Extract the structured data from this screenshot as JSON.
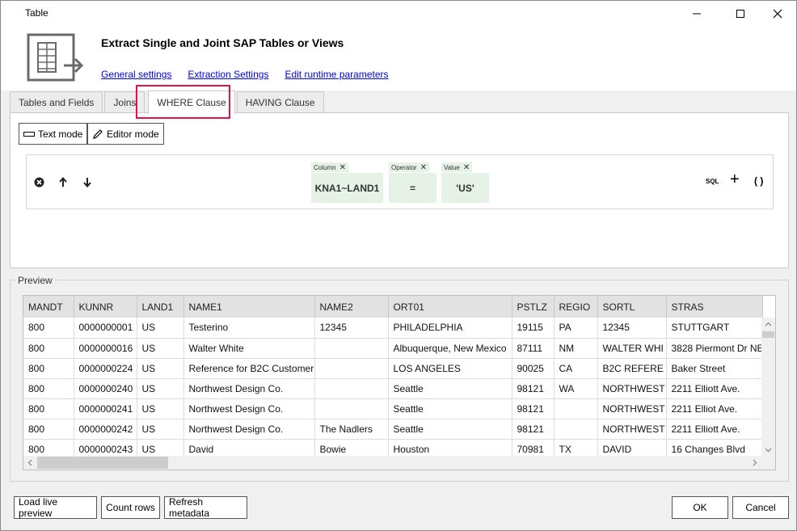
{
  "window": {
    "title": "Table"
  },
  "header": {
    "title": "Extract Single and Joint SAP Tables or Views",
    "links": [
      "General settings",
      "Extraction Settings",
      "Edit runtime parameters"
    ]
  },
  "tabs": [
    {
      "label": "Tables and Fields",
      "active": false
    },
    {
      "label": "Joins",
      "active": false
    },
    {
      "label": "WHERE Clause",
      "active": true
    },
    {
      "label": "HAVING Clause",
      "active": false
    }
  ],
  "where": {
    "text_mode": "Text mode",
    "editor_mode": "Editor mode",
    "chips": [
      {
        "label": "Column",
        "value": "KNA1~LAND1"
      },
      {
        "label": "Operator",
        "value": "="
      },
      {
        "label": "Value",
        "value": "'US'"
      }
    ],
    "sql_label": "SQL",
    "plus": "+",
    "parens": "( )"
  },
  "preview": {
    "label": "Preview",
    "columns": [
      "MANDT",
      "KUNNR",
      "LAND1",
      "NAME1",
      "NAME2",
      "ORT01",
      "PSTLZ",
      "REGIO",
      "SORTL",
      "STRAS"
    ],
    "rows": [
      [
        "800",
        "0000000001",
        "US",
        "Testerino",
        "12345",
        "PHILADELPHIA",
        "19115",
        "PA",
        "12345",
        "STUTTGART"
      ],
      [
        "800",
        "0000000016",
        "US",
        "Walter White",
        "",
        "Albuquerque, New Mexico",
        "87111",
        "NM",
        "WALTER WHI",
        "3828 Piermont Dr NE"
      ],
      [
        "800",
        "0000000224",
        "US",
        "Reference for B2C Customer",
        "",
        "LOS ANGELES",
        "90025",
        "CA",
        "B2C REFERE",
        "Baker Street"
      ],
      [
        "800",
        "0000000240",
        "US",
        "Northwest Design Co.",
        "",
        "Seattle",
        "98121",
        "WA",
        "NORTHWEST",
        "2211 Elliott Ave."
      ],
      [
        "800",
        "0000000241",
        "US",
        "Northwest Design Co.",
        "",
        "Seattle",
        "98121",
        "",
        "NORTHWEST",
        "2211 Elliot Ave."
      ],
      [
        "800",
        "0000000242",
        "US",
        "Northwest Design Co.",
        "The Nadlers",
        "Seattle",
        "98121",
        "",
        "NORTHWEST",
        "2211 Elliott Ave."
      ],
      [
        "800",
        "0000000243",
        "US",
        "David",
        "Bowie",
        "Houston",
        "70981",
        "TX",
        "DAVID",
        "16 Changes Blvd"
      ]
    ]
  },
  "footer": {
    "load_preview": "Load live preview",
    "count_rows": "Count rows",
    "refresh_metadata": "Refresh metadata",
    "ok": "OK",
    "cancel": "Cancel"
  },
  "colors": {
    "highlight": "#e0134f",
    "chip": "#e6f2e6",
    "link": "#0000ee"
  }
}
